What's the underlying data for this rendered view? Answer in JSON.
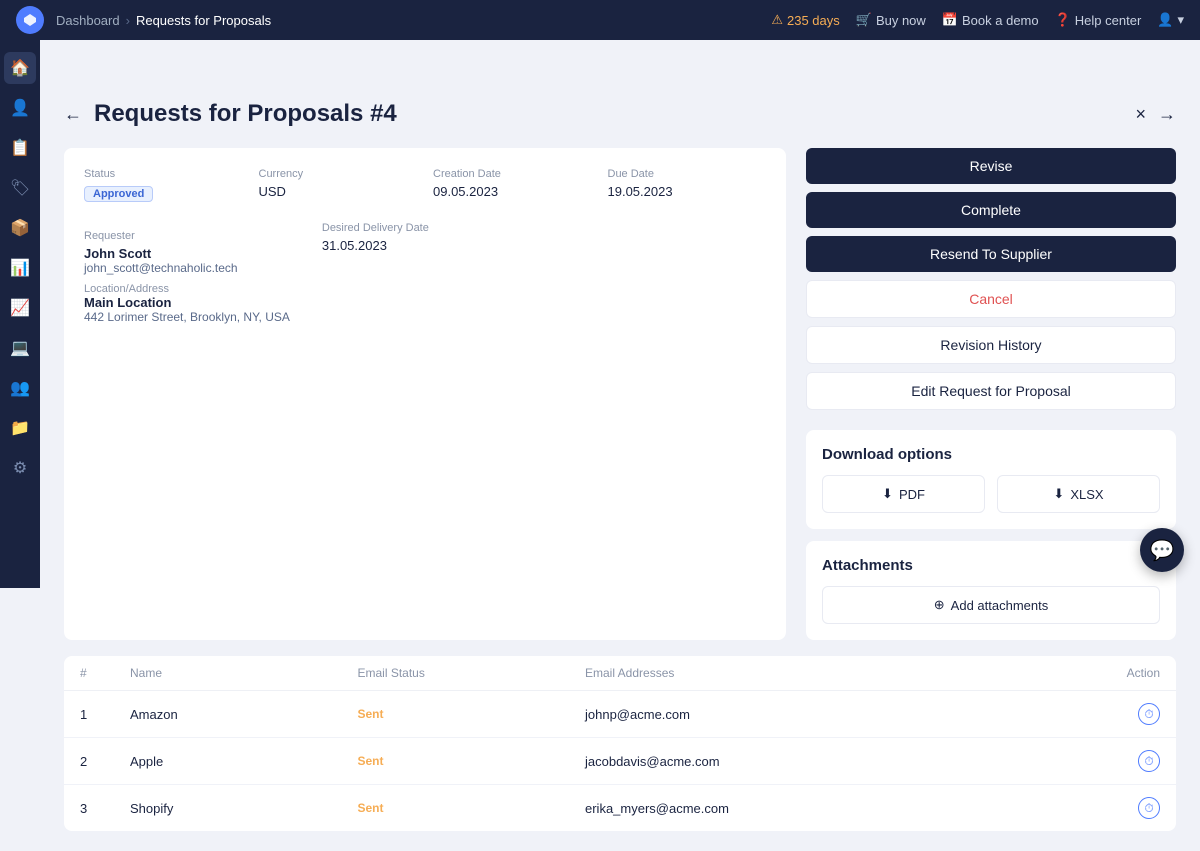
{
  "topnav": {
    "logo": "P",
    "breadcrumb": {
      "parent": "Dashboard",
      "current": "Requests for Proposals"
    },
    "trial_warning": "235 days",
    "buy_now": "Buy now",
    "book_demo": "Book a demo",
    "help_center": "Help center"
  },
  "page": {
    "title": "Requests for Proposals #4",
    "back_label": "←",
    "close_label": "×",
    "next_label": "→"
  },
  "detail": {
    "status_label": "Status",
    "status_value": "Approved",
    "currency_label": "Currency",
    "currency_value": "USD",
    "creation_date_label": "Creation Date",
    "creation_date_value": "09.05.2023",
    "due_date_label": "Due Date",
    "due_date_value": "19.05.2023",
    "requester_label": "Requester",
    "requester_name": "John Scott",
    "requester_email": "john_scott@technaholic.tech",
    "location_label": "Location/Address",
    "location_name": "Main Location",
    "location_address": "442 Lorimer Street, Brooklyn, NY, USA",
    "delivery_date_label": "Desired Delivery Date",
    "delivery_date_value": "31.05.2023"
  },
  "actions": {
    "revise": "Revise",
    "complete": "Complete",
    "resend_supplier": "Resend To Supplier",
    "cancel": "Cancel",
    "revision_history": "Revision History",
    "edit_request": "Edit Request for Proposal"
  },
  "download": {
    "title": "Download options",
    "pdf_label": "PDF",
    "xlsx_label": "XLSX"
  },
  "attachments": {
    "title": "Attachments",
    "add_label": "Add attachments"
  },
  "table": {
    "columns": {
      "number": "#",
      "name": "Name",
      "email_status": "Email Status",
      "email_addresses": "Email Addresses",
      "action": "Action"
    },
    "rows": [
      {
        "number": "1",
        "name": "Amazon",
        "email_status": "Sent",
        "email": "johnp@acme.com"
      },
      {
        "number": "2",
        "name": "Apple",
        "email_status": "Sent",
        "email": "jacobdavis@acme.com"
      },
      {
        "number": "3",
        "name": "Shopify",
        "email_status": "Sent",
        "email": "erika_myers@acme.com"
      }
    ]
  },
  "sidebar": {
    "icons": [
      "🏠",
      "👤",
      "📋",
      "🏷",
      "📦",
      "📊",
      "📈",
      "💻",
      "👥",
      "📁",
      "⚙"
    ]
  }
}
